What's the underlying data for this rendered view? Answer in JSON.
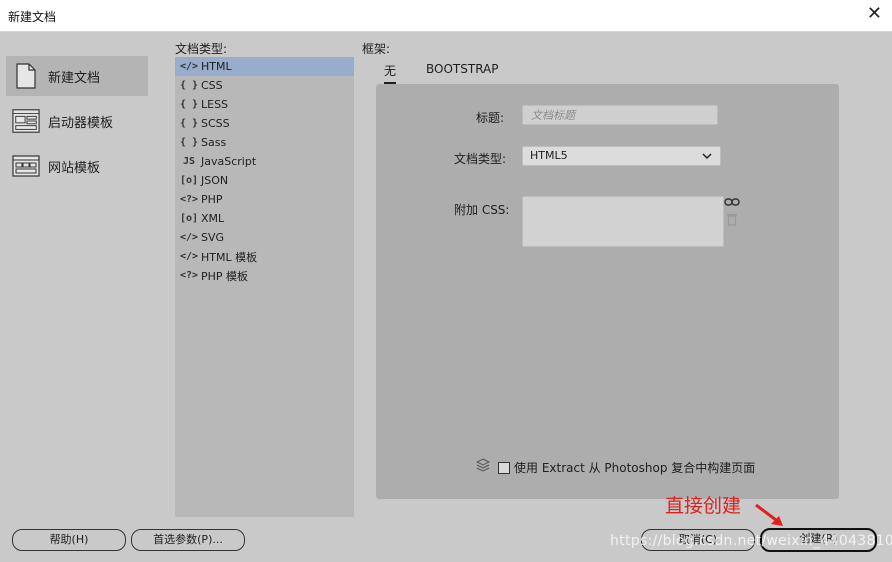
{
  "window": {
    "title": "新建文档",
    "close_glyph": "✕"
  },
  "leftnav": {
    "items": [
      {
        "label": "新建文档",
        "icon": "blank-document-icon",
        "active": true
      },
      {
        "label": "启动器模板",
        "icon": "starter-template-icon",
        "active": false
      },
      {
        "label": "网站模板",
        "icon": "site-template-icon",
        "active": false
      }
    ]
  },
  "doctypes": {
    "label": "文档类型:",
    "items": [
      {
        "icon": "</>",
        "label": "HTML",
        "active": true
      },
      {
        "icon": "{ }",
        "label": "CSS"
      },
      {
        "icon": "{ }",
        "label": "LESS"
      },
      {
        "icon": "{ }",
        "label": "SCSS"
      },
      {
        "icon": "{ }",
        "label": "Sass"
      },
      {
        "icon": "JS",
        "label": "JavaScript"
      },
      {
        "icon": "[o]",
        "label": "JSON"
      },
      {
        "icon": "<?>",
        "label": "PHP"
      },
      {
        "icon": "[o]",
        "label": "XML"
      },
      {
        "icon": "</>",
        "label": "SVG"
      },
      {
        "icon": "</>",
        "label": "HTML 模板"
      },
      {
        "icon": "<?>",
        "label": "PHP 模板"
      }
    ]
  },
  "framework": {
    "label": "框架:",
    "tabs": [
      {
        "label": "无",
        "active": true
      },
      {
        "label": "BOOTSTRAP",
        "active": false
      }
    ]
  },
  "form": {
    "title_label": "标题:",
    "title_placeholder": "文档标题",
    "doctype_label": "文档类型:",
    "doctype_value": "HTML5",
    "css_label": "附加 CSS:",
    "extract_label": "使用 Extract 从 Photoshop 复合中构建页面"
  },
  "buttons": {
    "help": "帮助(H)",
    "prefs": "首选参数(P)...",
    "cancel": "取消(C)",
    "create": "创建(R)"
  },
  "annotation": {
    "text": "直接创建",
    "color": "#e02020"
  },
  "watermark": "https://blog.csdn.net/weixin_44043810",
  "colors": {
    "accent_selection": "#98accb",
    "background": "#c9c9c9"
  }
}
